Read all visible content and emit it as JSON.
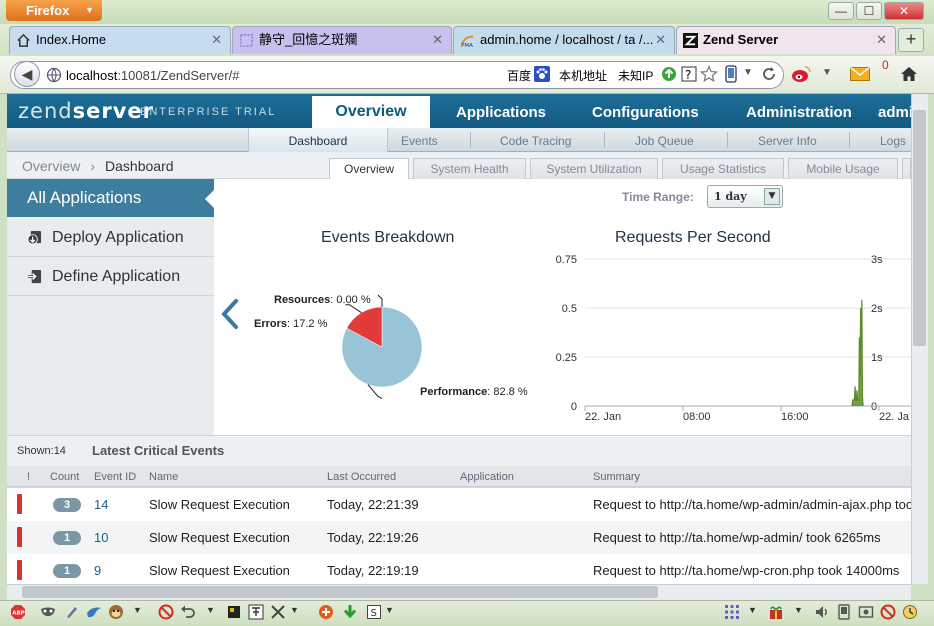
{
  "browser": {
    "app_button": "Firefox",
    "tabs": [
      {
        "label": "Index.Home"
      },
      {
        "label": "静守_回憶之斑斕"
      },
      {
        "label": "admin.home / localhost / ta /..."
      },
      {
        "label": "Zend Server"
      }
    ],
    "url_host": "localhost",
    "url_path": ":10081/ZendServer/#",
    "nav_items": [
      "百度",
      "本机地址",
      "未知IP"
    ],
    "mail_count": "0",
    "colors": {
      "tab1": "#c8dcf0",
      "tab2": "#c9c0f0",
      "tab3": "#c2dcee",
      "tab4": "#f2e4ec"
    }
  },
  "app": {
    "logo_main": "zend",
    "logo_bold": "server",
    "edition": "ENTERPRISE TRIAL",
    "main_tabs": [
      "Overview",
      "Applications",
      "Configurations",
      "Administration",
      "admi"
    ],
    "sub_tabs": [
      "Dashboard",
      "Events",
      "Code Tracing",
      "Job Queue",
      "Server Info",
      "Logs"
    ],
    "breadcrumb": [
      "Overview",
      "Dashboard"
    ],
    "panel_tabs": [
      "Overview",
      "System Health",
      "System Utilization",
      "Usage Statistics",
      "Mobile Usage"
    ],
    "sidebar": {
      "all": "All Applications",
      "items": [
        "Deploy Application",
        "Define Application"
      ]
    },
    "time_range_label": "Time Range:",
    "time_range_value": "1 day",
    "accent": "#3d7d9e"
  },
  "chart_data": [
    {
      "type": "pie",
      "title": "Events Breakdown",
      "labels": [
        "Resources",
        "Errors",
        "Performance"
      ],
      "values": [
        0.0,
        17.2,
        82.8
      ],
      "value_texts": [
        "0.00 %",
        "17.2 %",
        "82.8 %"
      ],
      "colors": [
        "#f0a030",
        "#e53a3a",
        "#97c4d6"
      ]
    },
    {
      "type": "area",
      "title": "Requests Per Second",
      "x_ticks": [
        "22. Jan",
        "08:00",
        "16:00",
        "22. Ja"
      ],
      "y_ticks": [
        "0",
        "0.25",
        "0.5",
        "0.75"
      ],
      "y2_ticks": [
        "0",
        "1s",
        "2s",
        "3s"
      ],
      "ylim": [
        0,
        0.75
      ],
      "x_domain_hours": [
        0,
        24
      ],
      "series": [
        {
          "x": [
            21.8,
            21.85,
            21.9,
            21.95,
            22.0,
            22.05,
            22.1,
            22.15,
            22.2,
            22.25,
            22.3,
            22.35,
            22.4,
            22.45,
            22.5,
            22.55,
            22.6,
            22.65,
            22.7
          ],
          "values": [
            0,
            0.03,
            0.03,
            0.03,
            0.04,
            0.1,
            0.03,
            0.03,
            0.08,
            0.03,
            0.03,
            0.03,
            0.35,
            0.15,
            0.5,
            0.3,
            0.54,
            0.05,
            0
          ]
        }
      ],
      "color": "#5e8a2a"
    }
  ],
  "events": {
    "shown": "Shown:14",
    "title": "Latest Critical Events",
    "columns": [
      "!",
      "Count",
      "Event ID",
      "Name",
      "Last Occurred",
      "Application",
      "Summary"
    ],
    "rows": [
      {
        "count": "3",
        "id": "14",
        "name": "Slow Request Execution",
        "time": "Today, 22:21:39",
        "app": "",
        "summary": "Request to http://ta.home/wp-admin/admin-ajax.php took"
      },
      {
        "count": "1",
        "id": "10",
        "name": "Slow Request Execution",
        "time": "Today, 22:19:26",
        "app": "",
        "summary": "Request to http://ta.home/wp-admin/ took 6265ms"
      },
      {
        "count": "1",
        "id": "9",
        "name": "Slow Request Execution",
        "time": "Today, 22:19:19",
        "app": "",
        "summary": "Request to http://ta.home/wp-cron.php took 14000ms"
      }
    ]
  }
}
